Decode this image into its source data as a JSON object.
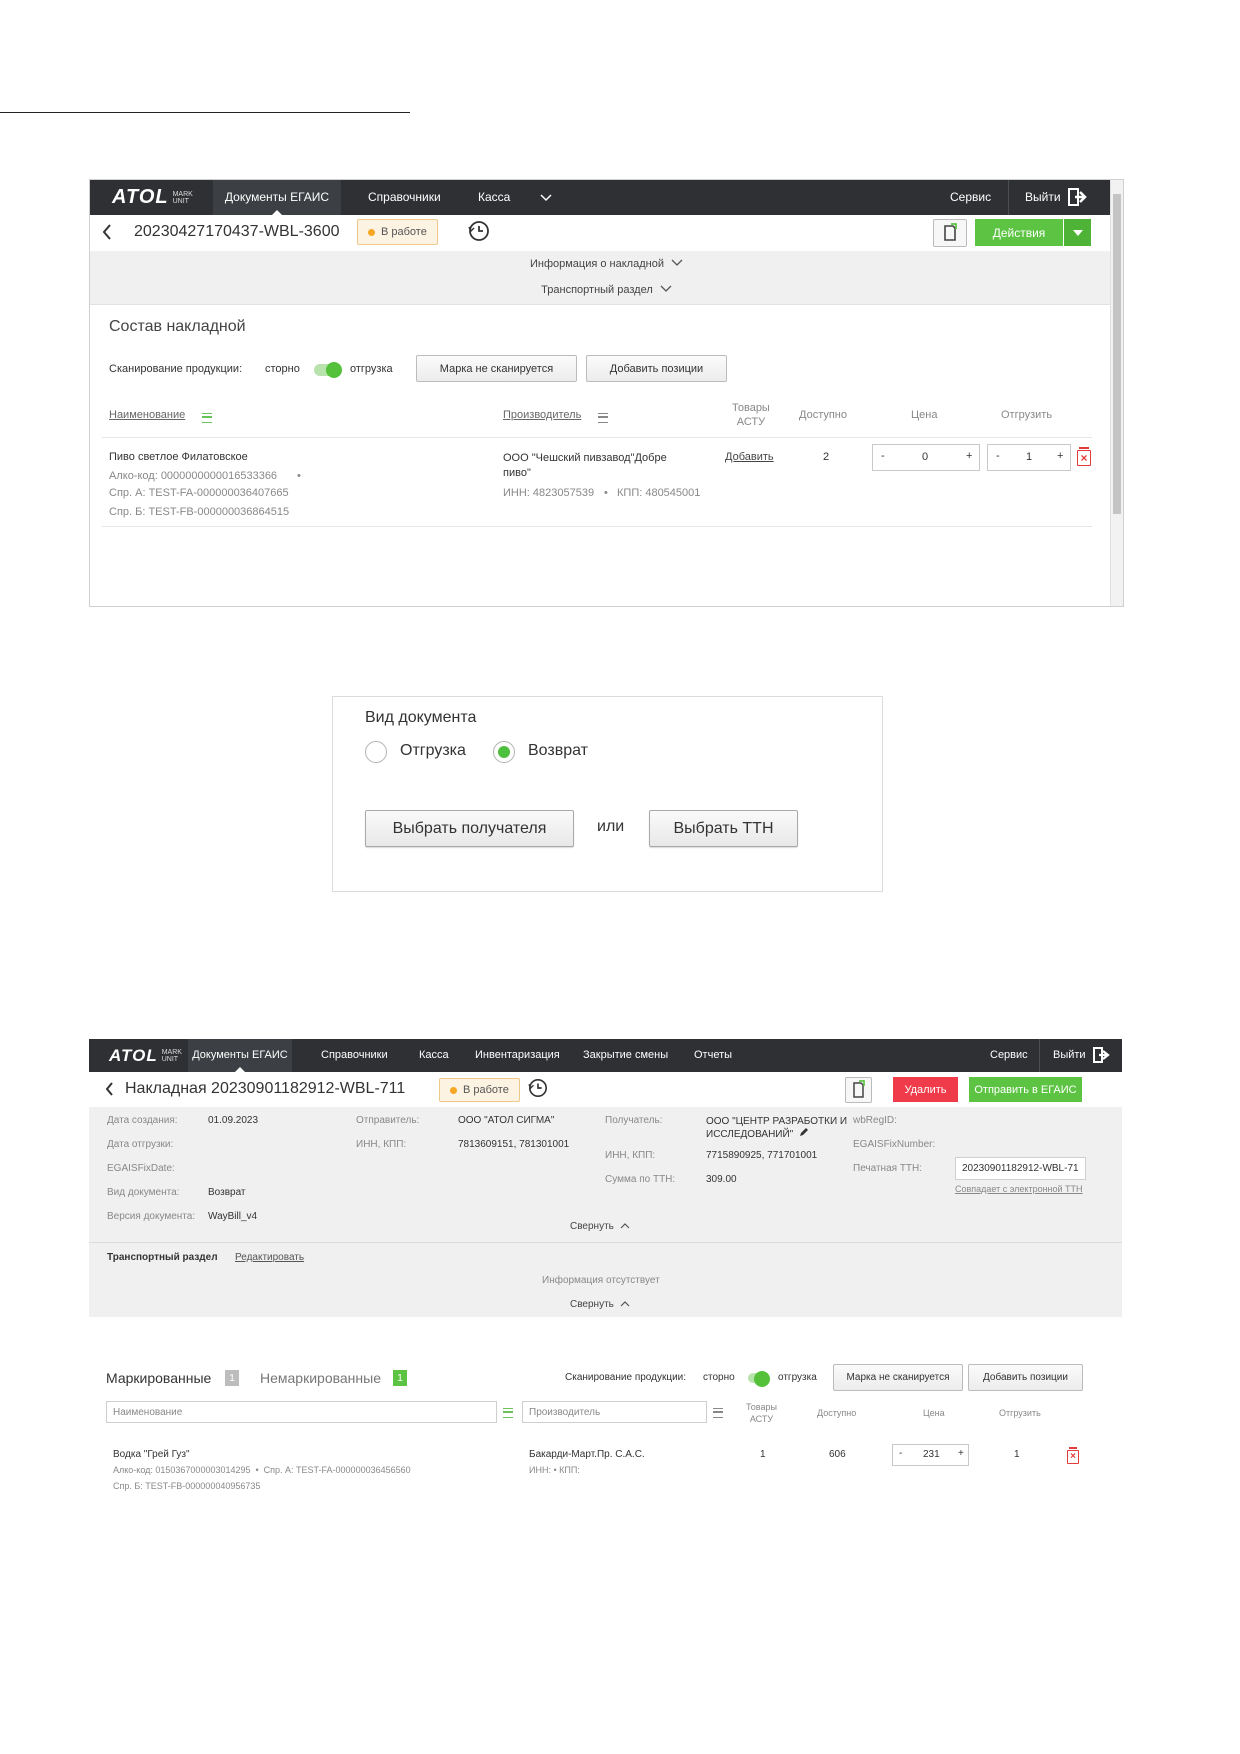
{
  "screen1": {
    "logo": {
      "word": "ATOL",
      "sub_line1": "MARK",
      "sub_line2": "UNIT"
    },
    "nav": [
      "Документы ЕГАИС",
      "Справочники",
      "Касса"
    ],
    "nav_right": {
      "service": "Сервис",
      "logout": "Выйти"
    },
    "doc_title": "20230427170437-WBL-3600",
    "status": "В работе",
    "actions_label": "Действия",
    "info_link": "Информация о накладной",
    "transport_link": "Транспортный раздел",
    "section_title": "Состав накладной",
    "scan": {
      "label": "Сканирование продукции:",
      "left": "сторно",
      "right": "отгрузка"
    },
    "buttons": {
      "mark": "Марка не сканируется",
      "add": "Добавить позиции"
    },
    "columns": {
      "name": "Наименование",
      "maker": "Производитель",
      "asty_1": "Товары",
      "asty_2": "АСТУ",
      "available": "Доступно",
      "price": "Цена",
      "ship": "Отгрузить"
    },
    "row": {
      "name": "Пиво светлое Филатовское",
      "alco": "Алко-код: 0000000000016533366",
      "spr_a": "Спр. А: TEST-FA-000000036407665",
      "spr_b": "Спр. Б: TEST-FB-000000036864515",
      "maker_1": "ООО \"Чешский пивзавод\"Добре",
      "maker_2": "пиво\"",
      "inn": "ИНН: 4823057539",
      "kpp": "КПП: 480545001",
      "asty": "Добавить",
      "available": "2",
      "price": "0",
      "ship": "1"
    }
  },
  "screen2": {
    "title": "Вид документа",
    "option1": "Отгрузка",
    "option2": "Возврат",
    "selected": "Возврат",
    "btn_recipient": "Выбрать получателя",
    "or": "или",
    "btn_ttn": "Выбрать ТТН"
  },
  "screen3": {
    "nav": [
      "Документы ЕГАИС",
      "Справочники",
      "Касса",
      "Инвентаризация",
      "Закрытие смены",
      "Отчеты"
    ],
    "nav_right": {
      "service": "Сервис",
      "logout": "Выйти"
    },
    "doc_title": "Накладная 20230901182912-WBL-711",
    "status": "В работе",
    "delete": "Удалить",
    "send": "Отправить в ЕГАИС",
    "info": {
      "created_label": "Дата создания:",
      "created": "01.09.2023",
      "shipped_label": "Дата отгрузки:",
      "fixdate_label": "EGAISFixDate:",
      "doctype_label": "Вид документа:",
      "doctype": "Возврат",
      "version_label": "Версия документа:",
      "version": "WayBill_v4",
      "sender_label": "Отправитель:",
      "sender": "ООО \"АТОЛ СИГМА\"",
      "sender_inn_label": "ИНН, КПП:",
      "sender_inn": "7813609151, 781301001",
      "recipient_label": "Получатель:",
      "recipient_1": "ООО \"ЦЕНТР РАЗРАБОТКИ И",
      "recipient_2": "ИССЛЕДОВАНИЙ\"",
      "recipient_inn_label": "ИНН, КПП:",
      "recipient_inn": "7715890925, 771701001",
      "sum_label": "Сумма по ТТН:",
      "sum": "309.00",
      "wbregid_label": "wbRegID:",
      "fixnumber_label": "EGAISFixNumber:",
      "print_ttn_label": "Печатная ТТН:",
      "print_ttn": "20230901182912-WBL-71",
      "match_note": "Совпадает с электронной ТТН"
    },
    "collapse": "Свернуть",
    "transport": {
      "title": "Транспортный раздел",
      "edit": "Редактировать",
      "empty": "Информация отсутствует",
      "collapse": "Свернуть"
    },
    "tabs": {
      "marked": "Маркированные",
      "marked_count": "1",
      "unmarked": "Немаркированные",
      "unmarked_count": "1"
    },
    "scan": {
      "label": "Сканирование продукции:",
      "left": "сторно",
      "right": "отгрузка"
    },
    "buttons": {
      "mark": "Марка не сканируется",
      "add": "Добавить позиции"
    },
    "filters": {
      "name_placeholder": "Наименование",
      "maker_placeholder": "Производитель"
    },
    "columns": {
      "asty_1": "Товары",
      "asty_2": "АСТУ",
      "available": "Доступно",
      "price": "Цена",
      "ship": "Отгрузить"
    },
    "row": {
      "name": "Водка \"Грей Гуз\"",
      "alco": "Алко-код: 0150367000003014295",
      "spr_a": "Спр. А: TEST-FA-000000036456560",
      "spr_b": "Спр. Б: TEST-FB-000000040956735",
      "maker": "Бакарди-Март.Пр. С.А.С.",
      "inn_kpp": "ИНН:  •  КПП:",
      "asty": "1",
      "available": "606",
      "price": "231",
      "ship": "1"
    }
  }
}
